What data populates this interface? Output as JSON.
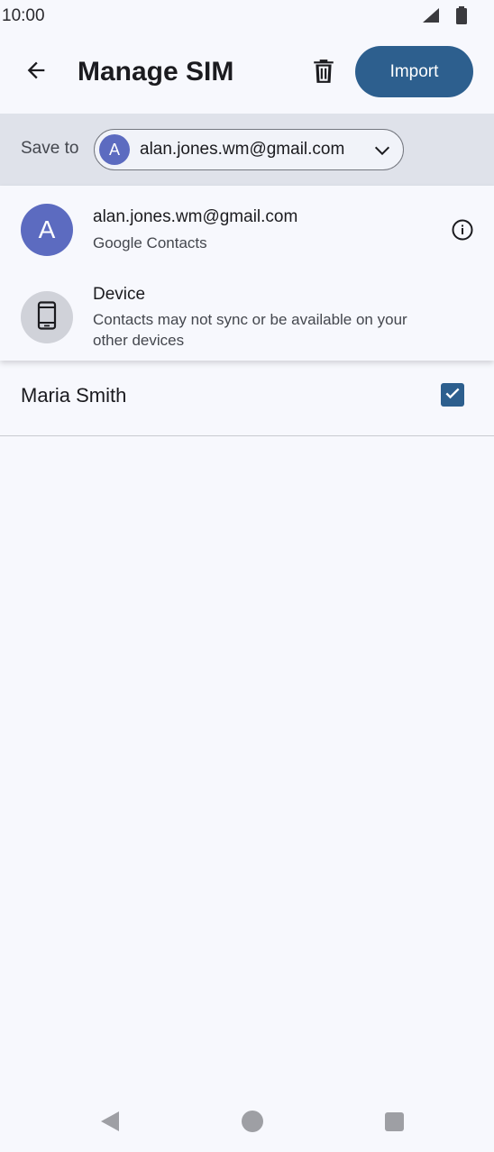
{
  "status_bar": {
    "time": "10:00",
    "icons": [
      "signal-icon",
      "battery-icon"
    ]
  },
  "app_bar": {
    "title": "Manage SIM",
    "back_icon": "arrow-back-icon",
    "delete_icon": "trash-icon",
    "import_label": "Import",
    "accent_color": "#2d5f8e"
  },
  "save_to": {
    "label": "Save to",
    "selected_account_initial": "A",
    "selected_account": "alan.jones.wm@gmail.com"
  },
  "dropdown": {
    "items": [
      {
        "initial": "A",
        "title": "alan.jones.wm@gmail.com",
        "subtitle": "Google Contacts",
        "avatar_color": "#5c6bc0"
      },
      {
        "icon": "phone-icon",
        "title": "Device",
        "subtitle": "Contacts may not sync or be available on your other devices"
      }
    ]
  },
  "contacts": [
    {
      "name": "Maria Smith",
      "checked": true
    }
  ],
  "nav_bar": {
    "icons": [
      "nav-back-icon",
      "nav-home-icon",
      "nav-recents-icon"
    ]
  }
}
